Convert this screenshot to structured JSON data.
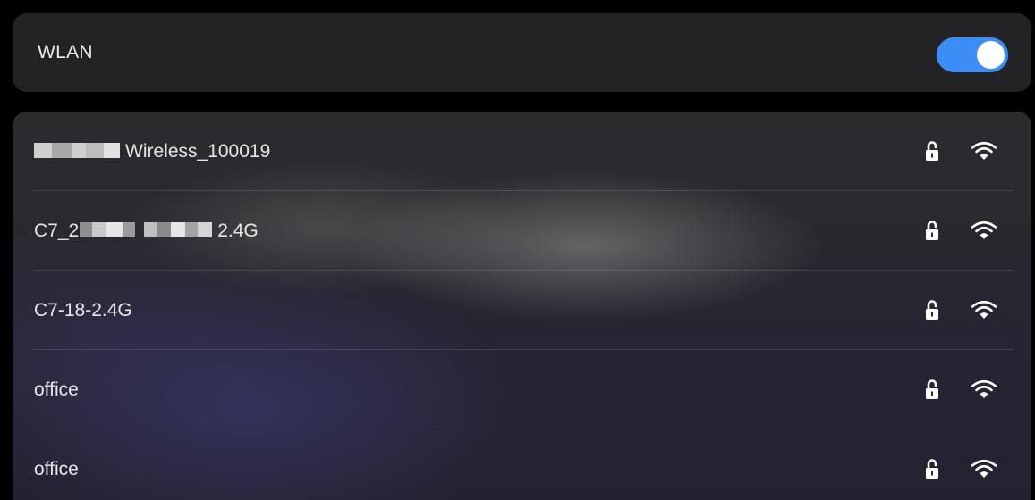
{
  "wlan": {
    "label": "WLAN",
    "enabled": true,
    "toggle_color": "#3c8ef6"
  },
  "networks": [
    {
      "name_prefix": "",
      "name": "Wireless_100019",
      "secured": true,
      "lock_icon": "lock-open-icon",
      "signal_icon": "wifi-full-icon",
      "partially_obscured": true
    },
    {
      "name_prefix": "C7_2",
      "name": "2.4G",
      "secured": true,
      "lock_icon": "lock-open-icon",
      "signal_icon": "wifi-full-icon",
      "partially_obscured": true
    },
    {
      "name_prefix": "",
      "name": "C7-18-2.4G",
      "secured": true,
      "lock_icon": "lock-open-icon",
      "signal_icon": "wifi-full-icon",
      "partially_obscured": false
    },
    {
      "name_prefix": "",
      "name": "office",
      "secured": true,
      "lock_icon": "lock-open-icon",
      "signal_icon": "wifi-full-icon",
      "partially_obscured": false
    },
    {
      "name_prefix": "",
      "name": "office",
      "secured": true,
      "lock_icon": "lock-open-icon",
      "signal_icon": "wifi-full-icon",
      "partially_obscured": false
    }
  ]
}
